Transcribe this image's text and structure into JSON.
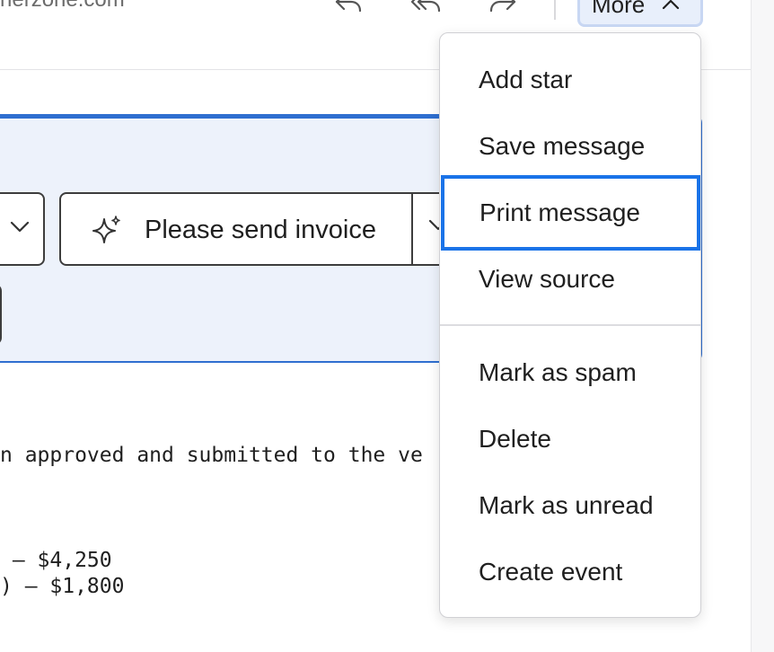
{
  "header": {
    "from_partial": "nerzone.com",
    "more_label": "More"
  },
  "toolbar": {
    "icons": [
      "reply-icon",
      "reply-all-icon",
      "forward-icon"
    ]
  },
  "suggestions": {
    "main_label": "Please send invoice"
  },
  "message_body": {
    "line1": "n approved and submitted to the ve",
    "line2": " — $4,250",
    "line3": ") — $1,800"
  },
  "menu": {
    "group1": [
      "Add star",
      "Save message",
      "Print message",
      "View source"
    ],
    "group2": [
      "Mark as spam",
      "Delete",
      "Mark as unread",
      "Create event"
    ],
    "focused_item": "Print message"
  },
  "colors": {
    "accent": "#1a73e8",
    "panel_border": "#2f6fd0",
    "panel_bg": "#edf2fb",
    "more_bg": "#e8effb"
  }
}
